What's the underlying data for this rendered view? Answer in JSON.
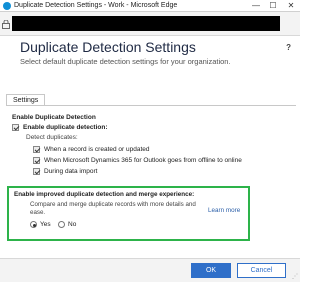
{
  "window": {
    "title": "Duplicate Detection Settings - Work - Microsoft Edge",
    "minimize": "—",
    "maximize": "☐",
    "close": "✕"
  },
  "addressbar": {
    "lock_icon": "lock-icon"
  },
  "header": {
    "title": "Duplicate Detection Settings",
    "subtitle": "Select default duplicate detection settings for your organization.",
    "help": "?"
  },
  "tabs": [
    {
      "label": "Settings",
      "active": true
    }
  ],
  "content": {
    "section_title": "Enable Duplicate Detection",
    "enable_label": "Enable duplicate detection:",
    "detect_label": "Detect duplicates:",
    "options": [
      {
        "label": "When a record is created or updated",
        "checked": true
      },
      {
        "label": "When Microsoft Dynamics 365 for Outlook goes from offline to online",
        "checked": true
      },
      {
        "label": "During data import",
        "checked": true
      }
    ],
    "improved": {
      "title": "Enable improved duplicate detection and merge experience:",
      "description": "Compare and merge duplicate records with more details and ease.",
      "learn_more": "Learn more",
      "yes": "Yes",
      "no": "No",
      "selected": "Yes"
    }
  },
  "footer": {
    "ok": "OK",
    "cancel": "Cancel"
  },
  "colors": {
    "accent": "#2f6fc9",
    "highlight": "#2db34a"
  }
}
